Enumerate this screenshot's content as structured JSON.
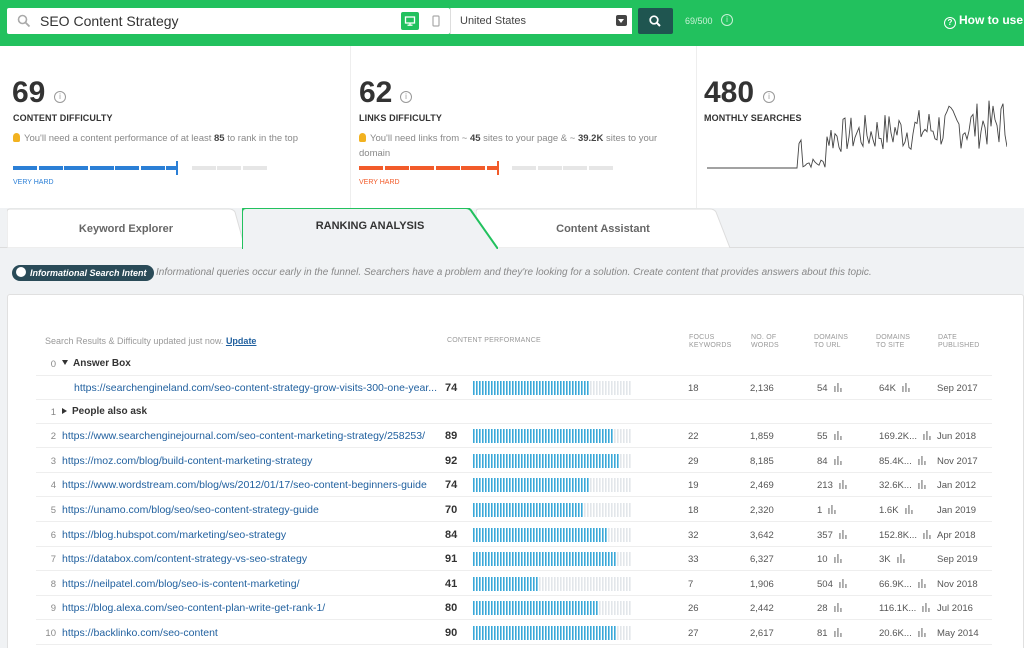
{
  "topbar": {
    "query": "SEO Content Strategy",
    "country": "United States",
    "usage": "69/500",
    "how_to_use": "How to use"
  },
  "metrics": {
    "content_difficulty": {
      "value": "69",
      "label": "CONTENT DIFFICULTY",
      "desc_pre": "You'll need a content performance of at least ",
      "desc_bold": "85",
      "desc_post": " to rank in the top",
      "level": "VERY HARD",
      "fill_segments": 7
    },
    "links_difficulty": {
      "value": "62",
      "label": "LINKS DIFFICULTY",
      "desc_pre": "You'll need links from ~ ",
      "desc_bold1": "45",
      "desc_mid": " sites to your page & ~ ",
      "desc_bold2": "39.2K",
      "desc_post": " sites to your domain",
      "level": "VERY HARD",
      "fill_segments": 6
    },
    "monthly_searches": {
      "value": "480",
      "label": "MONTHLY SEARCHES"
    }
  },
  "colors": {
    "accent_green": "#22c15e",
    "hard_blue": "#2b7fd6",
    "hard_orange": "#f25b2a",
    "link_blue": "#1f5f9e",
    "perf_bar": "#3aa8d8"
  },
  "tabs": [
    {
      "label": "Keyword Explorer",
      "active": false
    },
    {
      "label": "RANKING ANALYSIS",
      "active": true
    },
    {
      "label": "Content Assistant",
      "active": false
    }
  ],
  "intent": {
    "badge": "Informational Search Intent",
    "description": "Informational queries occur early in the funnel. Searchers have a problem and they're looking for a solution. Create content that provides answers about this topic."
  },
  "results": {
    "updated_text": "Search Results & Difficulty updated just now. ",
    "update_link": "Update",
    "columns": {
      "performance": "CONTENT PERFORMANCE",
      "focus": [
        "FOCUS",
        "KEYWORDS"
      ],
      "words": [
        "NO. OF",
        "WORDS"
      ],
      "domains_url": [
        "DOMAINS",
        "TO URL"
      ],
      "domains_site": [
        "DOMAINS",
        "TO SITE"
      ],
      "date": [
        "DATE",
        "PUBLISHED"
      ]
    },
    "groups": [
      {
        "index": "0",
        "label": "Answer Box"
      },
      {
        "index": "1",
        "label": "People also ask"
      }
    ],
    "rows": [
      {
        "index": "",
        "url": "https://searchengineland.com/seo-content-strategy-grow-visits-300-one-year...",
        "score": "74",
        "focus": "18",
        "words": "2,136",
        "domains_url": "54",
        "domains_site": "64K",
        "date": "Sep 2017"
      },
      {
        "index": "2",
        "url": "https://www.searchenginejournal.com/seo-content-marketing-strategy/258253/",
        "score": "89",
        "focus": "22",
        "words": "1,859",
        "domains_url": "55",
        "domains_site": "169.2K...",
        "date": "Jun 2018"
      },
      {
        "index": "3",
        "url": "https://moz.com/blog/build-content-marketing-strategy",
        "score": "92",
        "focus": "29",
        "words": "8,185",
        "domains_url": "84",
        "domains_site": "85.4K...",
        "date": "Nov 2017"
      },
      {
        "index": "4",
        "url": "https://www.wordstream.com/blog/ws/2012/01/17/seo-content-beginners-guide",
        "score": "74",
        "focus": "19",
        "words": "2,469",
        "domains_url": "213",
        "domains_site": "32.6K...",
        "date": "Jan 2012"
      },
      {
        "index": "5",
        "url": "https://unamo.com/blog/seo/seo-content-strategy-guide",
        "score": "70",
        "focus": "18",
        "words": "2,320",
        "domains_url": "1",
        "domains_site": "1.6K",
        "date": "Jan 2019"
      },
      {
        "index": "6",
        "url": "https://blog.hubspot.com/marketing/seo-strategy",
        "score": "84",
        "focus": "32",
        "words": "3,642",
        "domains_url": "357",
        "domains_site": "152.8K...",
        "date": "Apr 2018"
      },
      {
        "index": "7",
        "url": "https://databox.com/content-strategy-vs-seo-strategy",
        "score": "91",
        "focus": "33",
        "words": "6,327",
        "domains_url": "10",
        "domains_site": "3K",
        "date": "Sep 2019"
      },
      {
        "index": "8",
        "url": "https://neilpatel.com/blog/seo-is-content-marketing/",
        "score": "41",
        "focus": "7",
        "words": "1,906",
        "domains_url": "504",
        "domains_site": "66.9K...",
        "date": "Nov 2018"
      },
      {
        "index": "9",
        "url": "https://blog.alexa.com/seo-content-plan-write-get-rank-1/",
        "score": "80",
        "focus": "26",
        "words": "2,442",
        "domains_url": "28",
        "domains_site": "116.1K...",
        "date": "Jul 2016"
      },
      {
        "index": "10",
        "url": "https://backlinko.com/seo-content",
        "score": "90",
        "focus": "27",
        "words": "2,617",
        "domains_url": "81",
        "domains_site": "20.6K...",
        "date": "May 2014"
      }
    ]
  }
}
